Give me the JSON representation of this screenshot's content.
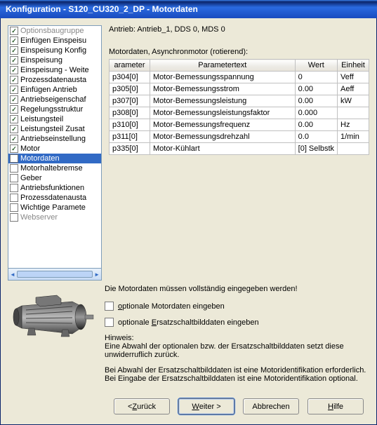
{
  "title": "Konfiguration - S120_CU320_2_DP - Motordaten",
  "tree": [
    {
      "label": "Optionsbaugruppe",
      "checked": true,
      "grey": true
    },
    {
      "label": "Einfügen Einspeisu",
      "checked": true
    },
    {
      "label": "Einspeisung Konfig",
      "checked": true
    },
    {
      "label": "Einspeisung",
      "checked": true
    },
    {
      "label": "Einspeisung - Weite",
      "checked": true
    },
    {
      "label": "Prozessdatenausta",
      "checked": true
    },
    {
      "label": "Einfügen Antrieb",
      "checked": true
    },
    {
      "label": "Antriebseigenschaf",
      "checked": true
    },
    {
      "label": "Regelungsstruktur",
      "checked": true
    },
    {
      "label": "Leistungsteil",
      "checked": true
    },
    {
      "label": "Leistungsteil Zusat",
      "checked": true
    },
    {
      "label": "Antriebseinstellung",
      "checked": true
    },
    {
      "label": "Motor",
      "checked": true
    },
    {
      "label": "Motordaten",
      "checked": false,
      "selected": true
    },
    {
      "label": "Motorhaltebremse",
      "checked": false
    },
    {
      "label": "Geber",
      "checked": false
    },
    {
      "label": "Antriebsfunktionen",
      "checked": false
    },
    {
      "label": "Prozessdatenausta",
      "checked": false
    },
    {
      "label": "Wichtige Paramete",
      "checked": false
    },
    {
      "label": "Webserver",
      "checked": false,
      "grey": true
    }
  ],
  "drive_line": "Antrieb: Antrieb_1, DDS 0, MDS 0",
  "section_label": "Motordaten, Asynchronmotor (rotierend):",
  "table": {
    "headers": {
      "param": "arameter",
      "text": "Parametertext",
      "wert": "Wert",
      "einheit": "Einheit"
    },
    "rows": [
      {
        "p": "p304[0]",
        "t": "Motor-Bemessungsspannung",
        "w": "0",
        "e": "Veff"
      },
      {
        "p": "p305[0]",
        "t": "Motor-Bemessungsstrom",
        "w": "0.00",
        "e": "Aeff"
      },
      {
        "p": "p307[0]",
        "t": "Motor-Bemessungsleistung",
        "w": "0.00",
        "e": "kW"
      },
      {
        "p": "p308[0]",
        "t": "Motor-Bemessungsleistungsfaktor",
        "w": "0.000",
        "e": ""
      },
      {
        "p": "p310[0]",
        "t": "Motor-Bemessungsfrequenz",
        "w": "0.00",
        "e": "Hz"
      },
      {
        "p": "p311[0]",
        "t": "Motor-Bemessungsdrehzahl",
        "w": "0.0",
        "e": "1/min"
      },
      {
        "p": "p335[0]",
        "t": "Motor-Kühlart",
        "w": "[0] Selbstk",
        "e": ""
      }
    ]
  },
  "mandatory_msg": "Die Motordaten müssen vollständig eingegeben werden!",
  "opt_motor": {
    "pre": "",
    "accel": "o",
    "post": "ptionale Motordaten eingeben"
  },
  "opt_ersatz": {
    "pre": "optionale ",
    "accel": "E",
    "post": "rsatzschaltbilddaten eingeben"
  },
  "hint_head": "Hinweis:",
  "hint1": "Eine Abwahl der optionalen bzw. der Ersatzschaltbilddaten setzt diese unwiderruflich zurück.",
  "hint2": "Bei Abwahl der Ersatzschaltbilddaten ist eine Motoridentifikation erforderlich. Bei Eingabe der Ersatzschaltbilddaten ist eine Motoridentifikation optional.",
  "buttons": {
    "back": {
      "pre": "< ",
      "accel": "Z",
      "post": "urück"
    },
    "next": {
      "pre": "",
      "accel": "W",
      "post": "eiter >"
    },
    "cancel": "Abbrechen",
    "help": {
      "pre": "",
      "accel": "H",
      "post": "ilfe"
    }
  }
}
